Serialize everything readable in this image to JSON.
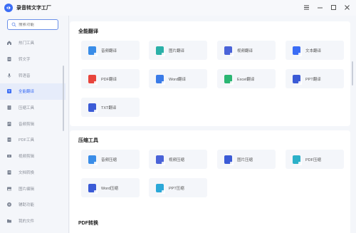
{
  "app": {
    "title": "录音转文字工厂",
    "accent": "#3b6df5"
  },
  "window_controls": {
    "menu_icon": "menu-icon",
    "minimize_icon": "minimize-icon",
    "maximize_icon": "maximize-icon",
    "close_icon": "close-icon"
  },
  "sidebar": {
    "search_placeholder": "搜索功能",
    "items": [
      {
        "label": "热门工具",
        "icon": "home-icon",
        "active": false
      },
      {
        "label": "转文字",
        "icon": "doc-icon",
        "active": false
      },
      {
        "label": "转语音",
        "icon": "voice-icon",
        "active": false
      },
      {
        "label": "全能翻译",
        "icon": "translate-icon",
        "active": true
      },
      {
        "label": "压缩工具",
        "icon": "compress-icon",
        "active": false
      },
      {
        "label": "音频剪辑",
        "icon": "audio-icon",
        "active": false
      },
      {
        "label": "PDF工具",
        "icon": "pdf-icon",
        "active": false
      },
      {
        "label": "视频剪辑",
        "icon": "video-icon",
        "active": false
      },
      {
        "label": "文档转换",
        "icon": "convert-icon",
        "active": false
      },
      {
        "label": "图片编辑",
        "icon": "image-icon",
        "active": false
      },
      {
        "label": "辅助功能",
        "icon": "helper-icon",
        "active": false
      },
      {
        "label": "我的文件",
        "icon": "folder-icon",
        "active": false
      }
    ]
  },
  "sections": [
    {
      "title": "全能翻译",
      "cards": [
        {
          "label": "音频翻译",
          "icon": "audio-translate-icon",
          "color": "#3a8de8"
        },
        {
          "label": "图片翻译",
          "icon": "image-translate-icon",
          "color": "#2bb0a8"
        },
        {
          "label": "视频翻译",
          "icon": "video-translate-icon",
          "color": "#4a63d8"
        },
        {
          "label": "文本翻译",
          "icon": "text-translate-icon",
          "color": "#3b6df5"
        },
        {
          "label": "PDF翻译",
          "icon": "pdf-translate-icon",
          "color": "#e8453c"
        },
        {
          "label": "Word翻译",
          "icon": "word-translate-icon",
          "color": "#3a7be8"
        },
        {
          "label": "Excel翻译",
          "icon": "excel-translate-icon",
          "color": "#2bb673"
        },
        {
          "label": "PPT翻译",
          "icon": "ppt-translate-icon",
          "color": "#3b5bd6"
        },
        {
          "label": "TXT翻译",
          "icon": "txt-translate-icon",
          "color": "#3b5bd6"
        }
      ]
    },
    {
      "title": "压缩工具",
      "cards": [
        {
          "label": "音频压缩",
          "icon": "audio-compress-icon",
          "color": "#3a8de8"
        },
        {
          "label": "视频压缩",
          "icon": "video-compress-icon",
          "color": "#4a63d8"
        },
        {
          "label": "图片压缩",
          "icon": "image-compress-icon",
          "color": "#3b5bd6"
        },
        {
          "label": "PDF压缩",
          "icon": "pdf-compress-icon",
          "color": "#2bb0c8"
        },
        {
          "label": "Word压缩",
          "icon": "word-compress-icon",
          "color": "#3b5bd6"
        },
        {
          "label": "PPT压缩",
          "icon": "ppt-compress-icon",
          "color": "#2ba8d8"
        }
      ]
    },
    {
      "title": "PDF转换",
      "cards": []
    }
  ]
}
